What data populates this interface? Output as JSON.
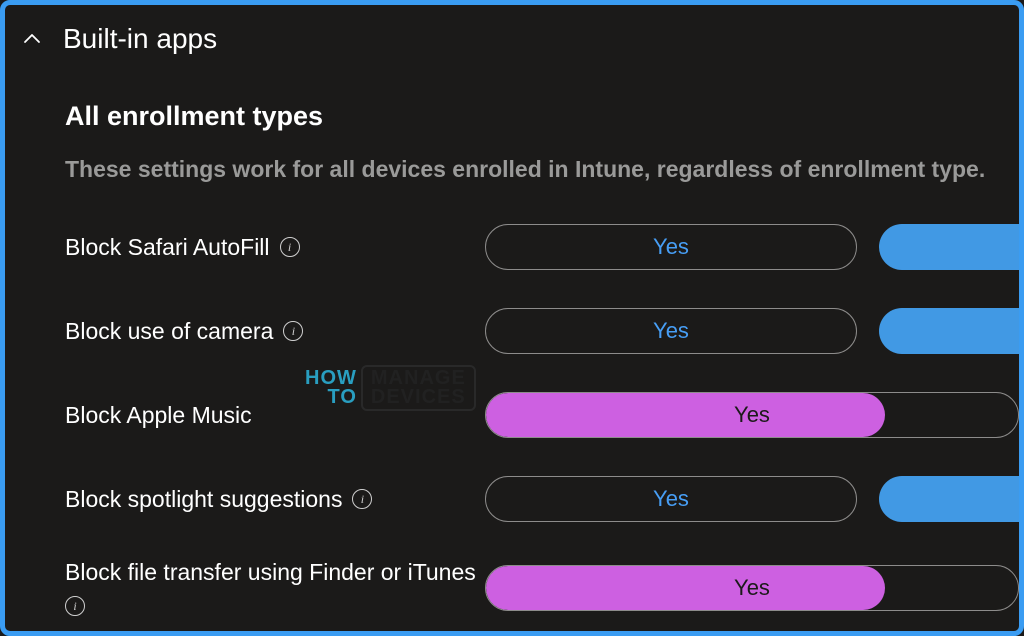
{
  "header": {
    "title": "Built-in apps"
  },
  "section": {
    "subtitle": "All enrollment types",
    "description": "These settings work for all devices enrolled in Intune, regardless of enrollment type."
  },
  "rows": [
    {
      "label": "Block Safari AutoFill",
      "info": true,
      "value": "Yes",
      "style": "blue",
      "sidePill": true
    },
    {
      "label": "Block use of camera",
      "info": true,
      "value": "Yes",
      "style": "blue",
      "sidePill": true
    },
    {
      "label": "Block Apple Music",
      "info": false,
      "value": "Yes",
      "style": "purple",
      "sidePill": false
    },
    {
      "label": "Block spotlight suggestions",
      "info": true,
      "value": "Yes",
      "style": "blue",
      "sidePill": true
    },
    {
      "label": "Block file transfer using Finder or iTunes",
      "info": true,
      "value": "Yes",
      "style": "purple",
      "sidePill": false
    }
  ],
  "watermark": {
    "left_top": "HOW",
    "left_bottom": "TO",
    "right_top": "MANAGE",
    "right_bottom": "DEVICES"
  }
}
